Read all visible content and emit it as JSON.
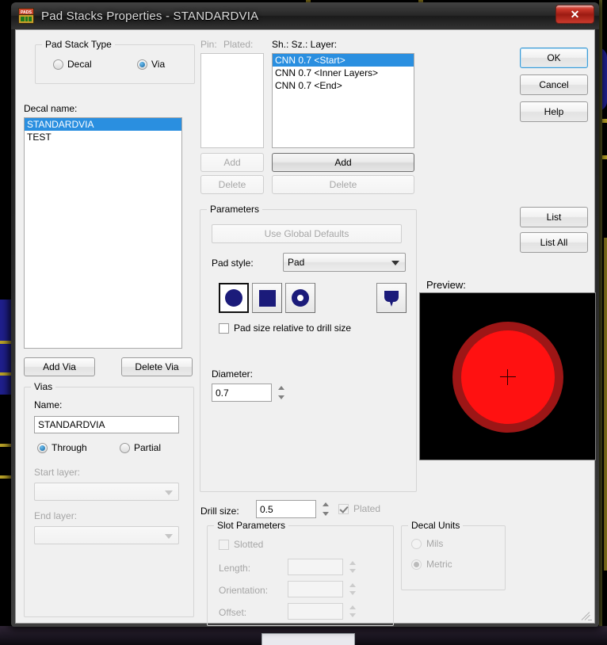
{
  "window": {
    "title": "Pad Stacks Properties - STANDARDVIA",
    "icon": "pads-app-icon",
    "close_label": "✕"
  },
  "pad_stack_type": {
    "group_label": "Pad Stack Type",
    "options": [
      {
        "label": "Decal",
        "selected": false
      },
      {
        "label": "Via",
        "selected": true
      }
    ]
  },
  "decal": {
    "label": "Decal name:",
    "items": [
      {
        "label": "STANDARDVIA",
        "selected": true
      },
      {
        "label": "TEST",
        "selected": false
      }
    ],
    "add_button": "Add Via",
    "delete_button": "Delete Via"
  },
  "pins": {
    "header_pin": "Pin:",
    "header_plated": "Plated:",
    "items": [],
    "add_button": "Add",
    "delete_button": "Delete"
  },
  "layers": {
    "header": "Sh.:  Sz.:  Layer:",
    "items": [
      {
        "label": "CNN 0.7 <Start>",
        "selected": true
      },
      {
        "label": "CNN 0.7 <Inner Layers>",
        "selected": false
      },
      {
        "label": "CNN 0.7 <End>",
        "selected": false
      }
    ],
    "add_button": "Add",
    "delete_button": "Delete"
  },
  "parameters": {
    "group_label": "Parameters",
    "use_global_defaults": "Use Global Defaults",
    "pad_style_label": "Pad style:",
    "pad_style_value": "Pad",
    "shapes": [
      {
        "name": "round",
        "selected": true
      },
      {
        "name": "square",
        "selected": false
      },
      {
        "name": "annular",
        "selected": false
      },
      {
        "name": "custom",
        "selected": false
      }
    ],
    "relative_checkbox_label": "Pad size relative to drill size",
    "relative_checked": false,
    "diameter_label": "Diameter:",
    "diameter_value": "0.7"
  },
  "preview": {
    "label": "Preview:",
    "background_color": "#000000",
    "outer_ring_color": "#9d1616",
    "pad_color": "#ff1111"
  },
  "vias": {
    "group_label": "Vias",
    "name_label": "Name:",
    "name_value": "STANDARDVIA",
    "type_options": [
      {
        "label": "Through",
        "selected": true
      },
      {
        "label": "Partial",
        "selected": false
      }
    ],
    "start_layer_label": "Start layer:",
    "start_layer_value": "",
    "end_layer_label": "End layer:",
    "end_layer_value": ""
  },
  "drill": {
    "label": "Drill size:",
    "value": "0.5",
    "plated_label": "Plated",
    "plated_checked": true
  },
  "slot": {
    "group_label": "Slot Parameters",
    "slotted_label": "Slotted",
    "slotted_checked": false,
    "fields": [
      {
        "label": "Length:",
        "value": ""
      },
      {
        "label": "Orientation:",
        "value": ""
      },
      {
        "label": "Offset:",
        "value": ""
      }
    ]
  },
  "decal_units": {
    "group_label": "Decal Units",
    "options": [
      {
        "label": "Mils",
        "selected": false
      },
      {
        "label": "Metric",
        "selected": true
      }
    ]
  },
  "actions": {
    "ok": "OK",
    "cancel": "Cancel",
    "help": "Help",
    "list": "List",
    "list_all": "List All"
  }
}
